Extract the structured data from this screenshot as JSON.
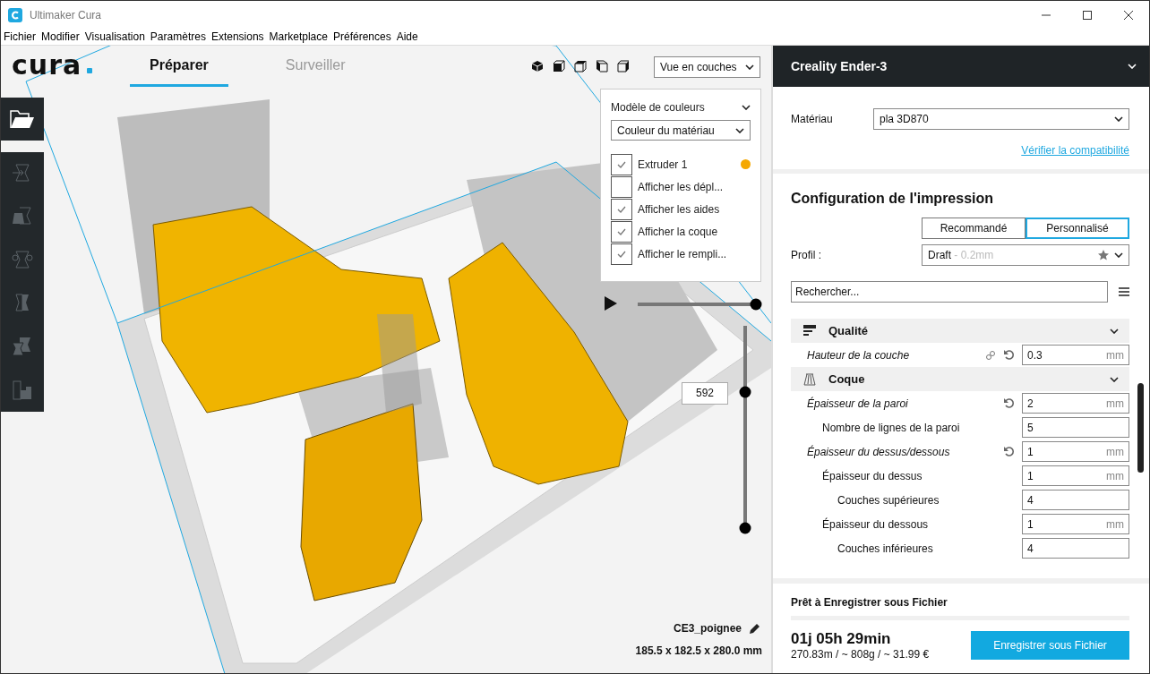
{
  "window": {
    "title": "Ultimaker Cura"
  },
  "menu": [
    "Fichier",
    "Modifier",
    "Visualisation",
    "Paramètres",
    "Extensions",
    "Marketplace",
    "Préférences",
    "Aide"
  ],
  "logo": {
    "text": "cura"
  },
  "stage_tabs": [
    {
      "label": "Préparer",
      "selected": true
    },
    {
      "label": "Surveiller",
      "selected": false
    }
  ],
  "view_dropdown": {
    "value": "Vue en couches"
  },
  "color_panel": {
    "title": "Modèle de couleurs",
    "scheme": "Couleur du matériau",
    "items": [
      {
        "label": "Extruder 1",
        "checked": true,
        "color": "#f5a800"
      },
      {
        "label": "Afficher les dépl...",
        "checked": false
      },
      {
        "label": "Afficher les aides",
        "checked": true
      },
      {
        "label": "Afficher la coque",
        "checked": true
      },
      {
        "label": "Afficher le rempli...",
        "checked": true
      }
    ]
  },
  "simulation": {
    "level": 1
  },
  "layer_slider": {
    "label": "592",
    "level": 0.67
  },
  "model": {
    "name": "CE3_poignee",
    "dimensions": "185.5 x 182.5 x 280.0 mm"
  },
  "printer": {
    "name": "Creality Ender-3"
  },
  "material": {
    "label": "Matériau",
    "value": "pla 3D870",
    "link": "Vérifier la compatibilité"
  },
  "print_setup": {
    "title": "Configuration de l'impression",
    "modes": [
      {
        "label": "Recommandé",
        "selected": false
      },
      {
        "label": "Personnalisé",
        "selected": true
      }
    ],
    "profile_label": "Profil :",
    "profile": "Draft",
    "profile_detail": "- 0.2mm",
    "search_placeholder": "Rechercher...",
    "settings": [
      {
        "kind": "category",
        "label": "Qualité",
        "children": [
          {
            "kind": "setting",
            "label": "Hauteur de la couche",
            "value": "0.3",
            "unit": "mm",
            "modified": true,
            "linked": true,
            "resettable": true
          }
        ]
      },
      {
        "kind": "category",
        "label": "Coque",
        "children": [
          {
            "kind": "setting",
            "label": "Épaisseur de la paroi",
            "value": "2",
            "unit": "mm",
            "modified": true,
            "linked": false,
            "resettable": true,
            "children": [
              {
                "kind": "setting",
                "label": "Nombre de lignes de la paroi",
                "value": "5",
                "modified": false,
                "linked": false,
                "resettable": false
              }
            ]
          },
          {
            "kind": "setting",
            "label": "Épaisseur du dessus/dessous",
            "value": "1",
            "unit": "mm",
            "modified": true,
            "linked": false,
            "resettable": true,
            "children": [
              {
                "kind": "setting",
                "label": "Épaisseur du dessus",
                "value": "1",
                "unit": "mm",
                "modified": false,
                "linked": false,
                "resettable": false,
                "children": [
                  {
                    "kind": "setting",
                    "label": "Couches supérieures",
                    "value": "4",
                    "modified": false,
                    "linked": false,
                    "resettable": false
                  }
                ]
              },
              {
                "kind": "setting",
                "label": "Épaisseur du dessous",
                "value": "1",
                "unit": "mm",
                "modified": false,
                "linked": false,
                "resettable": false,
                "children": [
                  {
                    "kind": "setting",
                    "label": "Couches inférieures",
                    "value": "4",
                    "modified": false,
                    "linked": false,
                    "resettable": false
                  }
                ]
              }
            ]
          }
        ]
      }
    ]
  },
  "footer": {
    "status": "Prêt à Enregistrer sous Fichier",
    "time": "01j 05h 29min",
    "stats": "270.83m / ~ 808g / ~ 31.99 €",
    "button": "Enregistrer sous Fichier"
  }
}
